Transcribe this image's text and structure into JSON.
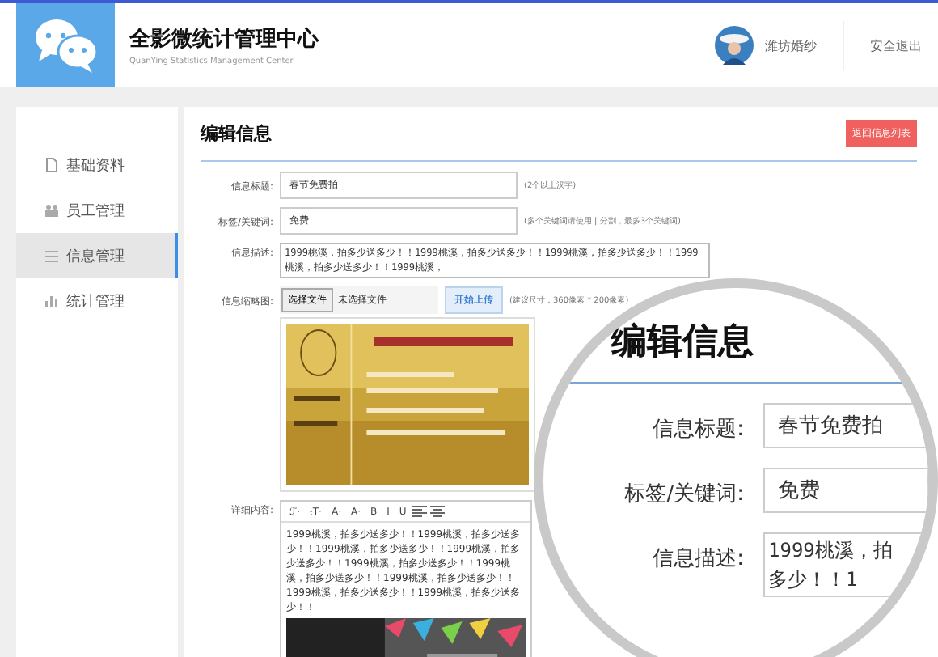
{
  "header": {
    "title": "全影微统计管理中心",
    "subtitle": "QuanYing Statistics Management Center",
    "user": "潍坊婚纱",
    "logout": "安全退出"
  },
  "sidebar": {
    "items": [
      {
        "label": "基础资料",
        "selected": false
      },
      {
        "label": "员工管理",
        "selected": false
      },
      {
        "label": "信息管理",
        "selected": true
      },
      {
        "label": "统计管理",
        "selected": false
      }
    ]
  },
  "form": {
    "heading": "编辑信息",
    "back_button": "返回信息列表",
    "title_label": "信息标题:",
    "title_value": "春节免费拍",
    "title_hint": "(2个以上汉字)",
    "keywords_label": "标签/关键词:",
    "keywords_value": "免费",
    "keywords_hint": "(多个关键词请使用 | 分割，最多3个关键词)",
    "desc_label": "信息描述:",
    "desc_value": "1999桃溪，拍多少送多少！！1999桃溪，拍多少送多少！！1999桃溪，拍多少送多少！！1999桃溪，拍多少送多少！！1999桃溪，",
    "image_label": "信息缩略图:",
    "choose_button": "选择文件",
    "no_file": "未选择文件",
    "upload_button": "开始上传",
    "image_hint": "(建议尺寸：360像素 * 200像素)",
    "detail_label": "详细内容:",
    "toolbar": [
      "ℱ·",
      "ₜT·",
      "A·",
      "A·",
      "B",
      "I",
      "U"
    ],
    "detail_text": "1999桃溪，拍多少送多少！！1999桃溪，拍多少送多少！！1999桃溪，拍多少送多少！！1999桃溪，拍多少送多少！！1999桃溪，拍多少送多少！！1999桃溪，拍多少送多少！！1999桃溪，拍多少送多少！！1999桃溪，拍多少送多少！！1999桃溪，拍多少送多少！！"
  },
  "magnifier": {
    "heading": "编辑信息",
    "rows": [
      {
        "label": "信息标题:",
        "lines": [
          "春节免费拍"
        ]
      },
      {
        "label": "标签/关键词:",
        "lines": [
          "免费"
        ]
      },
      {
        "label": "信息描述:",
        "lines": [
          "1999桃溪，拍",
          "多少！！1"
        ]
      }
    ]
  }
}
